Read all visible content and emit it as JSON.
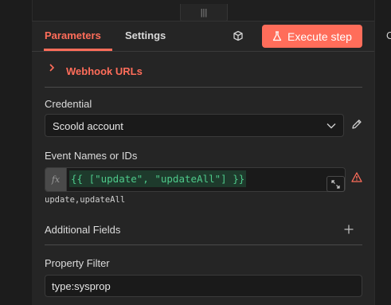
{
  "right_peek_text": "C",
  "drag_handle_glyph": "|||",
  "tabs": [
    {
      "label": "Parameters",
      "active": true
    },
    {
      "label": "Settings",
      "active": false
    }
  ],
  "execute": {
    "label": "Execute step",
    "color": "#ff6d5a"
  },
  "webhook": {
    "label": "Webhook URLs"
  },
  "credential": {
    "label": "Credential",
    "value": "Scoold account"
  },
  "event": {
    "label": "Event Names or IDs",
    "fx": "fx",
    "expression": "{{ [\"update\", \"updateAll\"] }}",
    "resolved": "update,updateAll"
  },
  "additional_fields": {
    "label": "Additional Fields"
  },
  "property_filter": {
    "label": "Property Filter",
    "value": "type:sysprop"
  },
  "colors": {
    "accent": "#ff6d5a",
    "panel_bg": "#252525",
    "input_bg": "#1a1a1a",
    "expression_green": "#4ec98a"
  },
  "icons": [
    "cube-icon",
    "flask-icon",
    "chevron-right-icon",
    "chevron-down-icon",
    "pencil-icon",
    "expand-icon",
    "warning-icon",
    "plus-icon"
  ]
}
